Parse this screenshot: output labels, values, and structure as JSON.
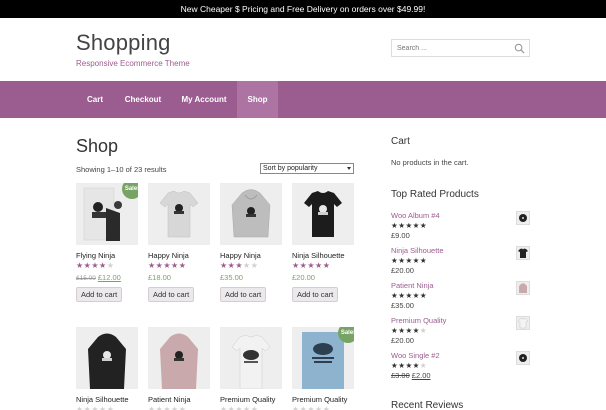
{
  "announcement": "New Cheaper $ Pricing and Free Delivery on orders over $49.99!",
  "brand": {
    "title": "Shopping",
    "tagline": "Responsive Ecommerce Theme"
  },
  "search": {
    "placeholder": "Search ..."
  },
  "nav": [
    {
      "label": "Cart"
    },
    {
      "label": "Checkout"
    },
    {
      "label": "My Account"
    },
    {
      "label": "Shop",
      "active": true
    }
  ],
  "shop": {
    "title": "Shop",
    "result_count": "Showing 1–10 of 23 results",
    "sort_selected": "Sort by popularity"
  },
  "products": [
    {
      "name": "Flying Ninja",
      "rating": 4,
      "old_price": "£15.00",
      "price": "£12.00",
      "sale": "Sale!",
      "button": "Add to cart"
    },
    {
      "name": "Happy Ninja",
      "rating": 5,
      "price": "£18.00",
      "button": "Add to cart"
    },
    {
      "name": "Happy Ninja",
      "rating": 3,
      "price": "£35.00",
      "button": "Add to cart"
    },
    {
      "name": "Ninja Silhouette",
      "rating": 5,
      "price": "£20.00",
      "button": "Add to cart"
    },
    {
      "name": "Ninja Silhouette"
    },
    {
      "name": "Patient Ninja"
    },
    {
      "name": "Premium Quality"
    },
    {
      "name": "Premium Quality",
      "sale": "Sale!"
    }
  ],
  "sidebar": {
    "cart_title": "Cart",
    "cart_empty": "No products in the cart.",
    "top_rated_title": "Top Rated Products",
    "top_rated": [
      {
        "name": "Woo Album #4",
        "rating": 5,
        "price": "£9.00"
      },
      {
        "name": "Ninja Silhouette",
        "rating": 5,
        "price": "£20.00"
      },
      {
        "name": "Patient Ninja",
        "rating": 5,
        "price": "£35.00"
      },
      {
        "name": "Premium Quality",
        "rating": 4,
        "price": "£20.00"
      },
      {
        "name": "Woo Single #2",
        "rating": 4,
        "old_price": "£3.00",
        "price": "£2.00"
      }
    ],
    "recent_reviews_title": "Recent Reviews"
  },
  "colors": {
    "accent": "#9b5c8f",
    "price": "#77a464",
    "topbar": "#000000"
  }
}
